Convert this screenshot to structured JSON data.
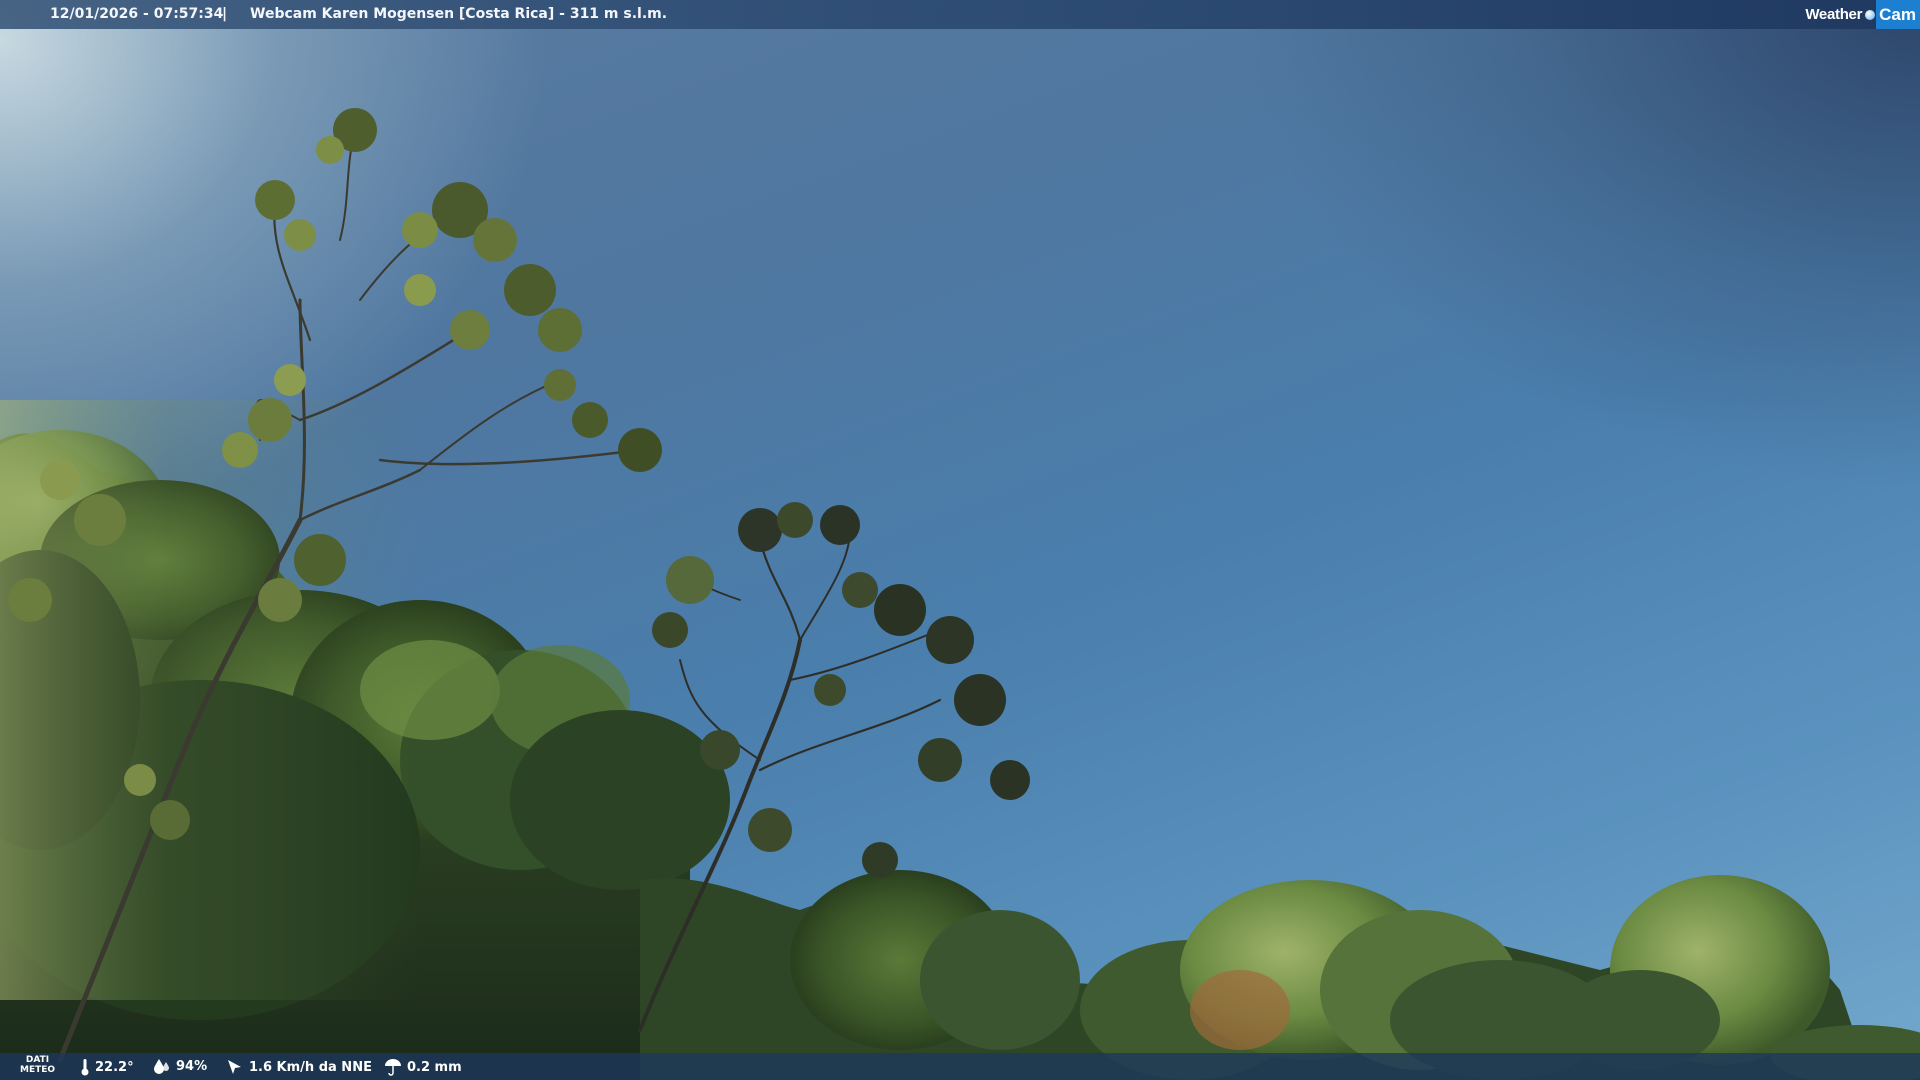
{
  "header": {
    "datetime": "12/01/2026 - 07:57:34",
    "separator": "|",
    "title": "Webcam Karen Mogensen [Costa Rica]  - 311 m s.l.m."
  },
  "logo": {
    "weather_text": "Weather",
    "cam_text": "Cam",
    "icon": "globe-icon"
  },
  "weather_data": {
    "section_label_line1": "DATI",
    "section_label_line2": "METEO",
    "temperature": "22.2°",
    "temperature_icon": "thermometer-icon",
    "humidity": "94%",
    "humidity_icon": "droplet-icon",
    "wind": "1.6 Km/h da NNE",
    "wind_icon": "wind-direction-icon",
    "rain": "0.2 mm",
    "rain_icon": "rain-icon"
  },
  "scene": {
    "description_colors": {
      "sky_light": "#cfe0e6",
      "sky_mid": "#4f7ba6",
      "sky_dark": "#2f4a72",
      "foliage_dark": "#1f3320",
      "foliage_mid": "#3d5a2a",
      "foliage_light": "#8fa65a"
    }
  }
}
